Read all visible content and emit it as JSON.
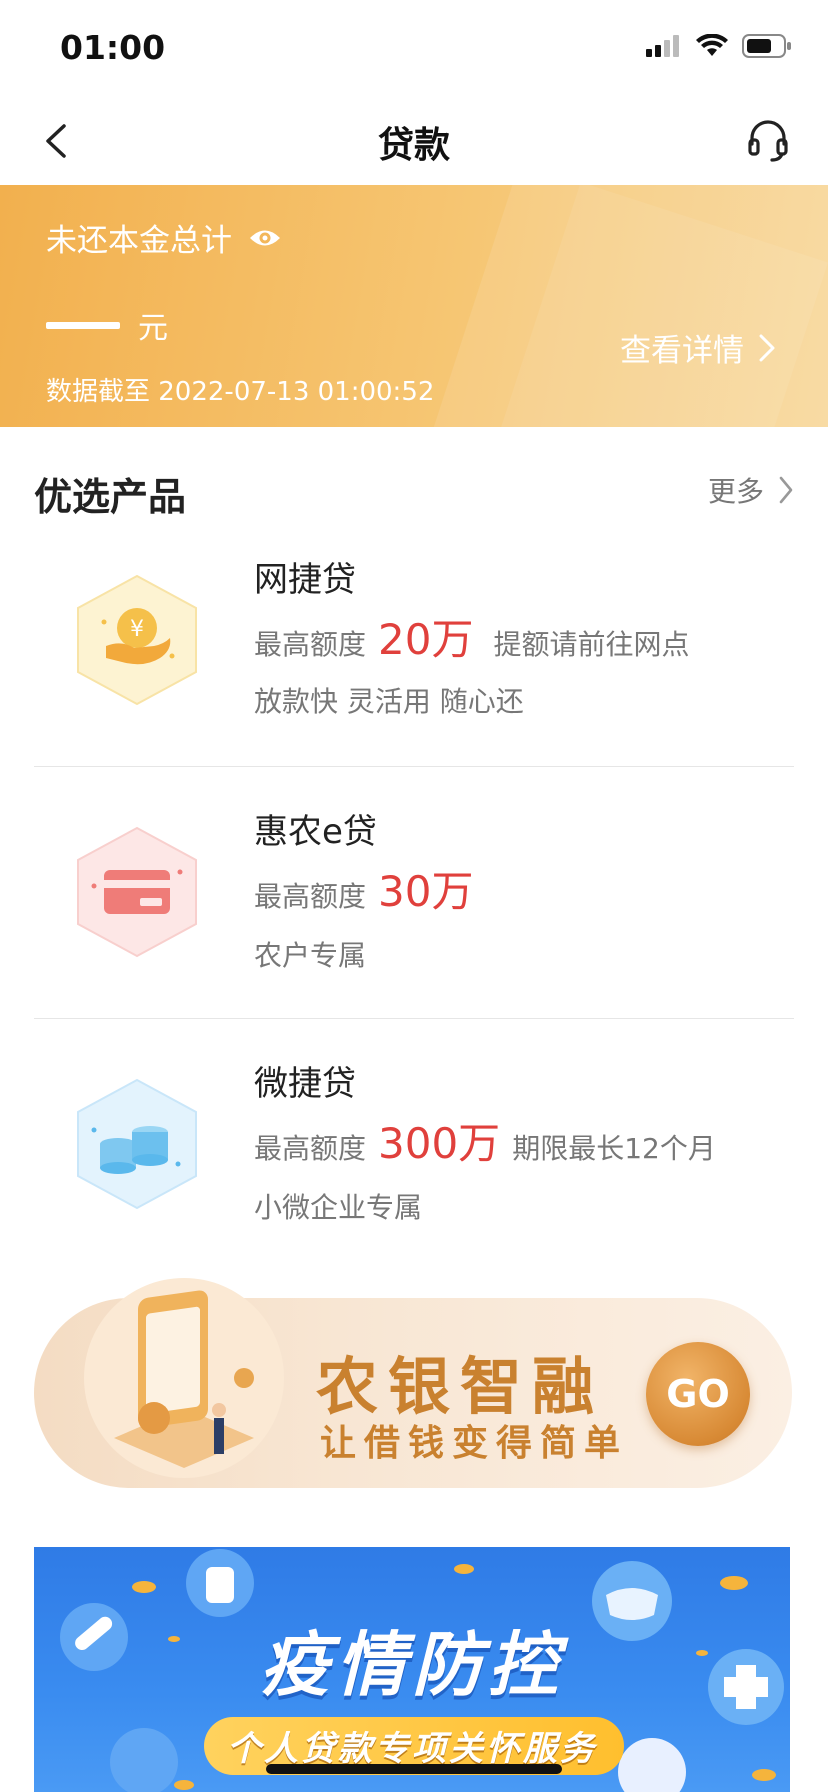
{
  "status_bar": {
    "time": "01:00"
  },
  "nav": {
    "title": "贷款"
  },
  "summary": {
    "label": "未还本金总计",
    "unit": "元",
    "timestamp": "数据截至 2022-07-13 01:00:52",
    "detail_label": "查看详情"
  },
  "section": {
    "title": "优选产品",
    "more_label": "更多"
  },
  "products": [
    {
      "name": "网捷贷",
      "limit_label": "最高额度",
      "limit_value": "20万",
      "extra": "提额请前往网点",
      "desc": "放款快 灵活用 随心还",
      "icon": "yen-hand-icon",
      "color": "#f5c04a"
    },
    {
      "name": "惠农e贷",
      "limit_label": "最高额度",
      "limit_value": "30万",
      "extra": "",
      "desc": "农户专属",
      "icon": "card-icon",
      "color": "#ef7c78"
    },
    {
      "name": "微捷贷",
      "limit_label": "最高额度",
      "limit_value": "300万",
      "extra": "期限最长12个月",
      "desc": "小微企业专属",
      "icon": "coin-stack-icon",
      "color": "#5ab8ec"
    }
  ],
  "promo1": {
    "title": "农银智融",
    "subtitle": "让借钱变得简单",
    "go_label": "GO"
  },
  "promo2": {
    "title": "疫情防控",
    "subtitle": "个人贷款专项关怀服务"
  },
  "colors": {
    "accent_red": "#e0403c",
    "banner_orange": "#f2b04e",
    "promo_gold": "#c9812f"
  }
}
